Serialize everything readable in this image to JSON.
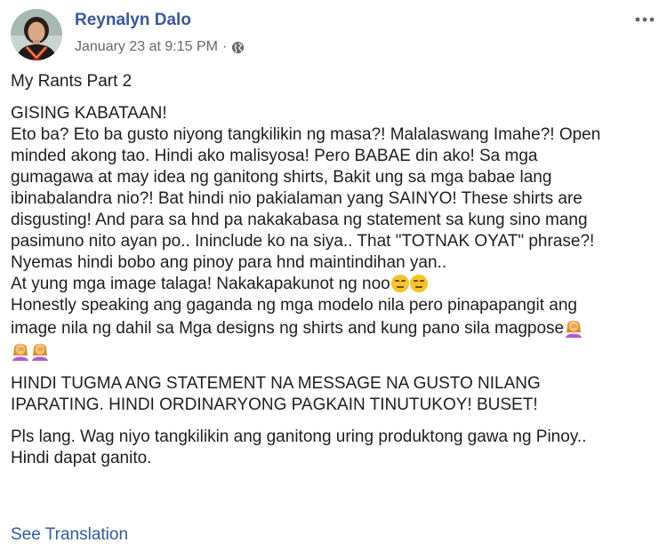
{
  "author": {
    "name": "Reynalyn Dalo"
  },
  "meta": {
    "timestamp": "January 23 at 9:15 PM",
    "separator": "·",
    "privacy_icon": "globe-icon"
  },
  "menu": {
    "more_icon": "more-horizontal-icon"
  },
  "post": {
    "title": "My Rants Part 2",
    "para1": [
      "GISING KABATAAN!",
      "Eto ba? Eto ba gusto niyong tangkilikin ng masa?! Malalaswang Imahe?! Open",
      "minded akong tao. Hindi ako malisyosa! Pero BABAE din ako! Sa mga",
      "gumagawa at may idea ng ganitong shirts, Bakit ung sa mga babae lang",
      "ibinabalandra nio?! Bat hindi nio pakialaman yang SAINYO! These shirts are",
      "disgusting! And para sa hnd pa nakakabasa ng statement sa kung sino mang",
      "pasimuno nito ayan po.. Ininclude ko na siya.. That \"TOTNAK OYAT\" phrase?!",
      "Nyemas hindi bobo ang pinoy para hnd maintindihan yan..",
      "At yung mga image talaga! Nakakapakunot ng noo",
      "Honestly speaking ang gaganda ng mga modelo nila pero pinapapangit ang",
      "image nila ng dahil sa Mga designs ng shirts and kung pano sila magpose"
    ],
    "emojis": {
      "unamused": "unamused-face-icon",
      "persevering": "persevering-face-icon",
      "facepalm": "woman-facepalming-icon"
    },
    "para2": [
      "HINDI TUGMA ANG STATEMENT NA MESSAGE NA GUSTO NILANG",
      "IPARATING. HINDI ORDINARYONG PAGKAIN TINUTUKOY! BUSET!"
    ],
    "para3": [
      "Pls lang. Wag niyo tangkilikin ang ganitong uring produktong gawa ng Pinoy..",
      "Hindi dapat ganito."
    ]
  },
  "footer": {
    "see_translation": "See Translation"
  },
  "colors": {
    "link": "#385898",
    "meta": "#616770",
    "text": "#1c1e21"
  }
}
